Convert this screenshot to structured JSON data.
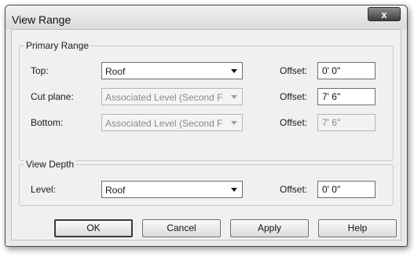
{
  "window": {
    "title": "View Range",
    "close_label": "x"
  },
  "primary_range": {
    "group_label": "Primary Range",
    "rows": [
      {
        "label": "Top:",
        "combo_value": "Roof",
        "combo_enabled": true,
        "offset_label": "Offset:",
        "offset_value": "0' 0\"",
        "offset_enabled": true
      },
      {
        "label": "Cut plane:",
        "combo_value": "Associated Level (Second F",
        "combo_enabled": false,
        "offset_label": "Offset:",
        "offset_value": "7' 6\"",
        "offset_enabled": true
      },
      {
        "label": "Bottom:",
        "combo_value": "Associated Level (Second F",
        "combo_enabled": false,
        "offset_label": "Offset:",
        "offset_value": "7' 6\"",
        "offset_enabled": false
      }
    ]
  },
  "view_depth": {
    "group_label": "View Depth",
    "row": {
      "label": "Level:",
      "combo_value": "Roof",
      "offset_label": "Offset:",
      "offset_value": "0' 0\""
    }
  },
  "buttons": {
    "ok": "OK",
    "cancel": "Cancel",
    "apply": "Apply",
    "help": "Help"
  }
}
